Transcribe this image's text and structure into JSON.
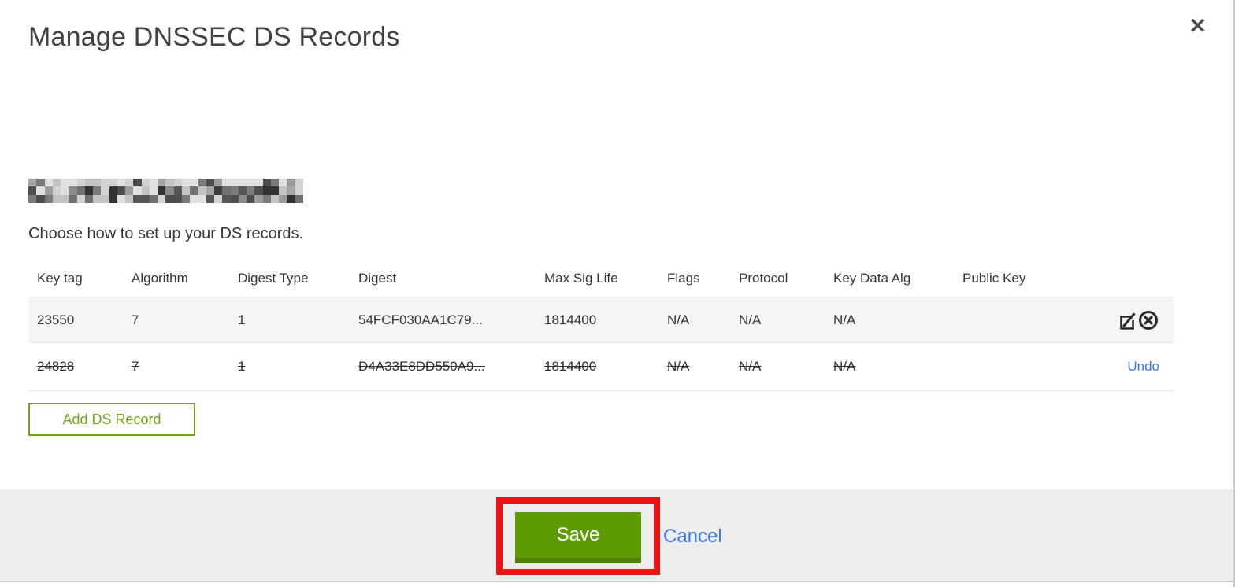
{
  "modal": {
    "title": "Manage DNSSEC DS Records",
    "close_glyph": "✕",
    "subtitle": "Choose how to set up your DS records.",
    "add_button_label": "Add DS Record",
    "save_label": "Save",
    "cancel_label": "Cancel",
    "undo_label": "Undo",
    "domain_redacted": true
  },
  "table": {
    "columns": [
      "Key tag",
      "Algorithm",
      "Digest Type",
      "Digest",
      "Max Sig Life",
      "Flags",
      "Protocol",
      "Key Data Alg",
      "Public Key"
    ],
    "rows": [
      {
        "key_tag": "23550",
        "algorithm": "7",
        "digest_type": "1",
        "digest": "54FCF030AA1C79...",
        "max_sig_life": "1814400",
        "flags": "N/A",
        "protocol": "N/A",
        "key_data_alg": "N/A",
        "public_key": "",
        "state": "normal",
        "actions": [
          "edit",
          "delete"
        ]
      },
      {
        "key_tag": "24828",
        "algorithm": "7",
        "digest_type": "1",
        "digest": "D4A33E8DD550A9...",
        "max_sig_life": "1814400",
        "flags": "N/A",
        "protocol": "N/A",
        "key_data_alg": "N/A",
        "public_key": "",
        "state": "deleted",
        "actions": [
          "undo"
        ]
      }
    ]
  },
  "colors": {
    "accent_green": "#6da41c",
    "save_green": "#5d9b02",
    "save_green_dark": "#517f0a",
    "link_blue": "#3b79ef",
    "annotation_red": "#ee1313",
    "footer_gray": "#ededed",
    "row_stripe_gray": "#f5f5f5",
    "redaction_palette": [
      "#3c3c3c",
      "#565656",
      "#707070",
      "#8b8b8b",
      "#a6a6a6",
      "#c3c3c3",
      "#7b7b7b",
      "#4d4d4d",
      "#9c9c9c",
      "#d2d2d2",
      "#333333",
      "#e0e0e0"
    ]
  }
}
